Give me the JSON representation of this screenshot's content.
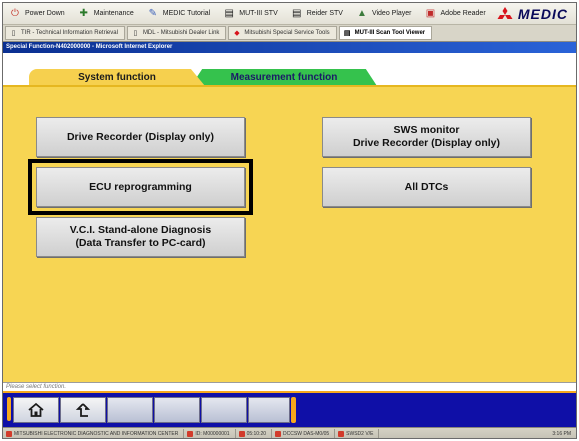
{
  "toolbar": {
    "items": [
      {
        "label": "Power Down",
        "icon": "power-icon",
        "color": "#c43b2f"
      },
      {
        "label": "Maintenance",
        "icon": "wrench-icon",
        "color": "#2b7a2b"
      },
      {
        "label": "MEDIC Tutorial",
        "icon": "tutorial-icon",
        "color": "#3a5fb8"
      },
      {
        "label": "MUT-III STV",
        "icon": "mut-icon",
        "color": "#333333"
      },
      {
        "label": "Reider STV",
        "icon": "reider-icon",
        "color": "#333333"
      },
      {
        "label": "Video Player",
        "icon": "video-icon",
        "color": "#3c7b3c"
      },
      {
        "label": "Adobe Reader",
        "icon": "adobe-icon",
        "color": "#c02b2b"
      }
    ],
    "logo_text": "MEDIC"
  },
  "browser_tabs": [
    {
      "label": "TIR - Technical Information Retrieval",
      "icon": "document-icon"
    },
    {
      "label": "MDL - Mitsubishi Dealer Link",
      "icon": "document-icon"
    },
    {
      "label": "Mitsubishi Special Service Tools",
      "icon": "mitsubishi-icon"
    },
    {
      "label": "MUT-III Scan Tool Viewer",
      "icon": "mut-icon"
    }
  ],
  "window_title": "Special Function-N402000000 - Microsoft Internet Explorer",
  "function_tabs": {
    "system": "System function",
    "measurement": "Measurement function"
  },
  "buttons": {
    "drive_recorder": "Drive Recorder (Display only)",
    "sws_line1": "SWS monitor",
    "sws_line2": "Drive Recorder (Display only)",
    "ecu": "ECU reprogramming",
    "all_dtcs": "All DTCs",
    "vci_line1": "V.C.I. Stand-alone Diagnosis",
    "vci_line2": "(Data Transfer to PC-card)"
  },
  "status_text": "Please select function.",
  "taskbar": {
    "items": [
      "MITSUBISHI ELECTRONIC DIAGNOSTIC AND INFORMATION CENTER",
      "ID: M00000001",
      "05:10:20",
      "DCCSW DAS-M0/05",
      "SWSD2 V/E"
    ],
    "clock": "3:16 PM"
  },
  "colors": {
    "panel": "#f7d553",
    "system_tab": "#f6d04e",
    "measurement_tab": "#35c24d",
    "nav_bar": "#0f0fa7",
    "accent": "#f6a81e"
  }
}
